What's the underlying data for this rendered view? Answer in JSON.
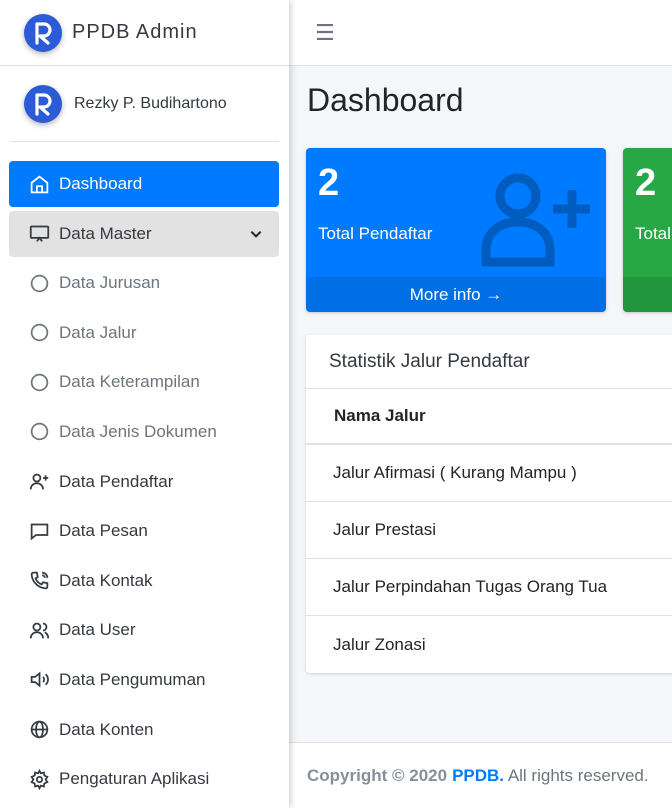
{
  "brand": {
    "title": "PPDB Admin"
  },
  "user": {
    "name": "Rezky P. Budihartono"
  },
  "sidebar": {
    "items": [
      {
        "label": "Dashboard",
        "icon": "home-icon",
        "state": "active"
      },
      {
        "label": "Data Master",
        "icon": "monitor-icon",
        "state": "open"
      },
      {
        "label": "Data Jurusan",
        "icon": "circle-icon",
        "state": "sub"
      },
      {
        "label": "Data Jalur",
        "icon": "circle-icon",
        "state": "sub"
      },
      {
        "label": "Data Keterampilan",
        "icon": "circle-icon",
        "state": "sub"
      },
      {
        "label": "Data Jenis Dokumen",
        "icon": "circle-icon",
        "state": "sub"
      },
      {
        "label": "Data Pendaftar",
        "icon": "user-plus-icon",
        "state": ""
      },
      {
        "label": "Data Pesan",
        "icon": "message-icon",
        "state": ""
      },
      {
        "label": "Data Kontak",
        "icon": "phone-icon",
        "state": ""
      },
      {
        "label": "Data User",
        "icon": "users-icon",
        "state": ""
      },
      {
        "label": "Data Pengumuman",
        "icon": "speaker-icon",
        "state": ""
      },
      {
        "label": "Data Konten",
        "icon": "globe-icon",
        "state": ""
      },
      {
        "label": "Pengaturan Aplikasi",
        "icon": "gear-icon",
        "state": ""
      }
    ]
  },
  "header": {
    "menu_icon": "☰"
  },
  "page": {
    "title": "Dashboard"
  },
  "boxes": [
    {
      "value": "2",
      "label": "Total Pendaftar",
      "footer": "More info →",
      "color": "#007bff"
    },
    {
      "value": "2",
      "label": "Total",
      "color": "#28a745"
    }
  ],
  "card": {
    "title": "Statistik Jalur Pendaftar",
    "column_header": "Nama Jalur",
    "rows": [
      "Jalur Afirmasi ( Kurang Mampu )",
      "Jalur Prestasi",
      "Jalur Perpindahan Tugas Orang Tua",
      "Jalur Zonasi"
    ]
  },
  "footer": {
    "copyright": "Copyright © 2020",
    "brand": "PPDB.",
    "rights": " All rights reserved."
  }
}
